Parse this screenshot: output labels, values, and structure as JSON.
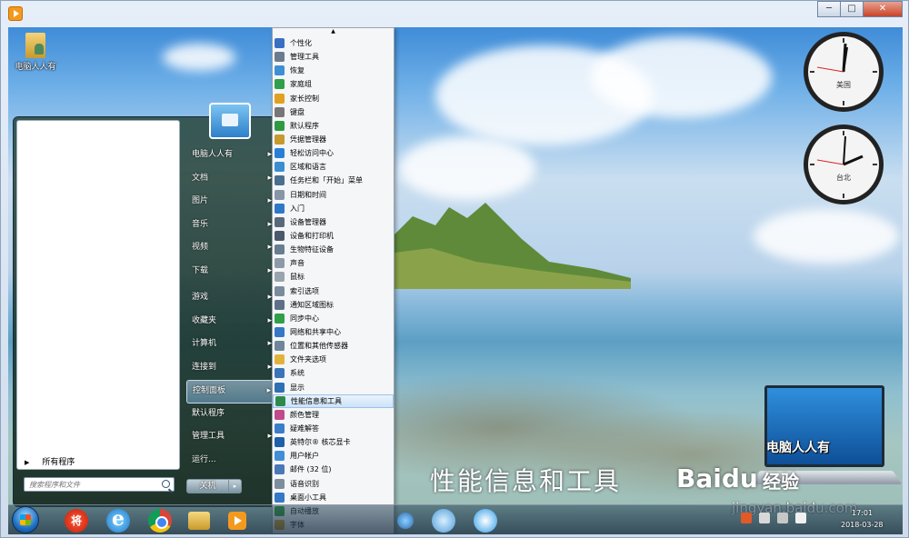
{
  "window": {
    "minimize_label": "─",
    "maximize_label": "□",
    "close_label": "✕"
  },
  "desktop": {
    "icon_label": "电脑人人有"
  },
  "start_menu": {
    "all_programs_label": "所有程序",
    "search_placeholder": "搜索程序和文件",
    "shutdown_label": "关机",
    "shutdown_arrow": "▸",
    "right_items": [
      {
        "label": "电脑人人有"
      },
      {
        "label": "文档"
      },
      {
        "label": "图片"
      },
      {
        "label": "音乐"
      },
      {
        "label": "视频"
      },
      {
        "label": "下载"
      },
      {
        "label": "游戏"
      },
      {
        "label": "收藏夹"
      },
      {
        "label": "计算机"
      },
      {
        "label": "连接到"
      },
      {
        "label": "控制面板"
      },
      {
        "label": "默认程序"
      },
      {
        "label": "管理工具"
      },
      {
        "label": "运行..."
      }
    ]
  },
  "control_panel_menu": {
    "scroll_up": "▲",
    "hovered_index": 27,
    "items": [
      {
        "label": "个性化",
        "color": "#3a6fc4"
      },
      {
        "label": "管理工具",
        "color": "#6b7b8c"
      },
      {
        "label": "恢复",
        "color": "#3f8fd6"
      },
      {
        "label": "家庭组",
        "color": "#2f9f4a"
      },
      {
        "label": "家长控制",
        "color": "#e0a020"
      },
      {
        "label": "键盘",
        "color": "#777777"
      },
      {
        "label": "默认程序",
        "color": "#2e9b3e"
      },
      {
        "label": "凭据管理器",
        "color": "#c69a2c"
      },
      {
        "label": "轻松访问中心",
        "color": "#2a7fd4"
      },
      {
        "label": "区域和语言",
        "color": "#3b8fd0"
      },
      {
        "label": "任务栏和「开始」菜单",
        "color": "#4a6f8f"
      },
      {
        "label": "日期和时间",
        "color": "#8796a6"
      },
      {
        "label": "入门",
        "color": "#2f78c8"
      },
      {
        "label": "设备管理器",
        "color": "#5a6a7a"
      },
      {
        "label": "设备和打印机",
        "color": "#4a5a6a"
      },
      {
        "label": "生物特征设备",
        "color": "#6a7d8f"
      },
      {
        "label": "声音",
        "color": "#8d9aa8"
      },
      {
        "label": "鼠标",
        "color": "#9aa4ad"
      },
      {
        "label": "索引选项",
        "color": "#7a8b9c"
      },
      {
        "label": "通知区域图标",
        "color": "#5e7188"
      },
      {
        "label": "同步中心",
        "color": "#2f9f4a"
      },
      {
        "label": "网络和共享中心",
        "color": "#3478c6"
      },
      {
        "label": "位置和其他传感器",
        "color": "#6f8598"
      },
      {
        "label": "文件夹选项",
        "color": "#e2b33c"
      },
      {
        "label": "系统",
        "color": "#3c74b8"
      },
      {
        "label": "显示",
        "color": "#2f6fb4"
      },
      {
        "label": "性能信息和工具",
        "color": "#2d8a4a"
      },
      {
        "label": "颜色管理",
        "color": "#c04a8a"
      },
      {
        "label": "疑难解答",
        "color": "#3b7dc7"
      },
      {
        "label": "英特尔® 核芯显卡",
        "color": "#1d5fa8"
      },
      {
        "label": "用户帐户",
        "color": "#3f8fd6"
      },
      {
        "label": "邮件 (32 位)",
        "color": "#4a78b8"
      },
      {
        "label": "语音识别",
        "color": "#7d8d9c"
      },
      {
        "label": "桌面小工具",
        "color": "#3478c6"
      },
      {
        "label": "自动播放",
        "color": "#2e9b3e"
      },
      {
        "label": "字体",
        "color": "#d4a52c"
      }
    ]
  },
  "taskbar": {
    "jiang_label": "将",
    "time": "17:01",
    "date": "2018-03-28"
  },
  "gadgets": {
    "clock1_city": "美国",
    "clock2_city": "台北"
  },
  "watermark": {
    "laptop_brand": "电脑人人有",
    "caption": "性能信息和工具",
    "baidu_logo": "Baidu",
    "baidu_sub": "经验",
    "baidu_url": "jingyan.baidu.com"
  }
}
